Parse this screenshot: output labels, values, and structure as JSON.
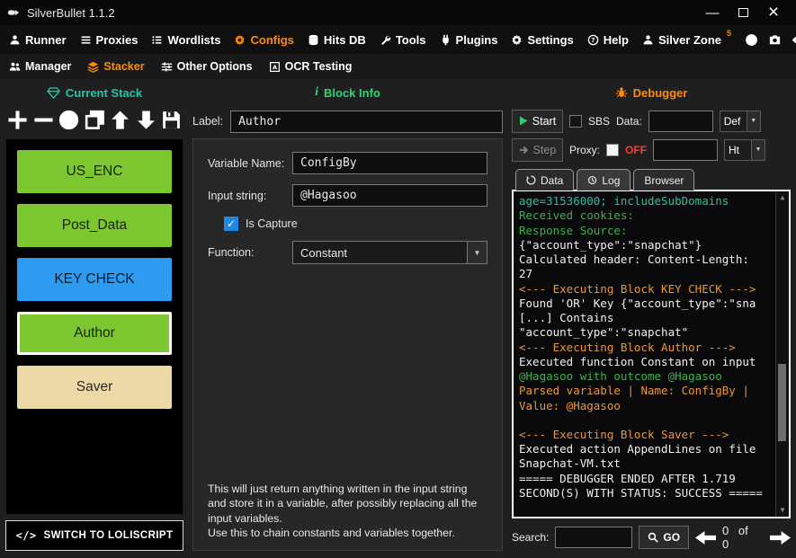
{
  "titlebar": {
    "title": "SilverBullet 1.1.2",
    "minimize": "—",
    "close": "×"
  },
  "menu": {
    "items": [
      {
        "label": "Runner"
      },
      {
        "label": "Proxies"
      },
      {
        "label": "Wordlists"
      },
      {
        "label": "Configs"
      },
      {
        "label": "Hits DB"
      },
      {
        "label": "Tools"
      },
      {
        "label": "Plugins"
      },
      {
        "label": "Settings"
      },
      {
        "label": "Help"
      },
      {
        "label": "Silver Zone",
        "badge": "5"
      }
    ]
  },
  "submenu": {
    "items": [
      {
        "label": "Manager"
      },
      {
        "label": "Stacker"
      },
      {
        "label": "Other Options"
      },
      {
        "label": "OCR Testing"
      }
    ]
  },
  "stack": {
    "header": "Current Stack",
    "blocks": [
      {
        "label": "US_ENC",
        "color": "#7CC62F"
      },
      {
        "label": "Post_Data",
        "color": "#7CC62F"
      },
      {
        "label": "KEY CHECK",
        "color": "#2D9BF0"
      },
      {
        "label": "Author",
        "color": "#7CC62F",
        "selected": true
      },
      {
        "label": "Saver",
        "color": "#EBD9A8"
      }
    ],
    "switch_icon": "</>",
    "switch_button": "SWITCH TO LOLISCRIPT"
  },
  "block_info": {
    "header": "Block Info",
    "label_caption": "Label:",
    "label_value": "Author",
    "fields": {
      "variable_name_caption": "Variable Name:",
      "variable_name_value": "ConfigBy",
      "input_string_caption": "Input string:",
      "input_string_value": "@Hagasoo",
      "is_capture_label": "Is Capture",
      "function_caption": "Function:",
      "function_value": "Constant"
    },
    "description": "This will just return anything written in the input string and store it in a variable, after possibly replacing all the input variables.\nUse this to chain constants and variables together."
  },
  "debugger": {
    "header": "Debugger",
    "controls": {
      "start": "Start",
      "sbs": "SBS",
      "data_caption": "Data:",
      "data_value": "",
      "data_dropdown": "Def",
      "step": "Step",
      "proxy_caption": "Proxy:",
      "proxy_state": "OFF",
      "proxy_value": "",
      "proxy_dropdown": "Ht"
    },
    "tabs": [
      {
        "label": "Data"
      },
      {
        "label": "Log"
      },
      {
        "label": "Browser"
      }
    ],
    "log": [
      {
        "c": "teal",
        "t": "age=31536000; includeSubDomains"
      },
      {
        "c": "green",
        "t": "Received cookies:"
      },
      {
        "c": "green",
        "t": "Response Source:"
      },
      {
        "c": "white",
        "t": "{\"account_type\":\"snapchat\"}"
      },
      {
        "c": "white",
        "t": "Calculated header: Content-Length: 27"
      },
      {
        "c": "orange",
        "t": "<--- Executing Block KEY CHECK --->"
      },
      {
        "c": "white",
        "t": "Found 'OR' Key {\"account_type\":\"sna [...] Contains \"account_type\":\"snapchat\""
      },
      {
        "c": "orange",
        "t": "<--- Executing Block Author --->"
      },
      {
        "c": "white",
        "t": "Executed function Constant on input"
      },
      {
        "c": "green",
        "t": "@Hagasoo with outcome @Hagasoo"
      },
      {
        "c": "orange",
        "t": "Parsed variable | Name: ConfigBy | Value: @Hagasoo"
      },
      {
        "c": "white",
        "t": ""
      },
      {
        "c": "orange",
        "t": "<--- Executing Block Saver --->"
      },
      {
        "c": "white",
        "t": "Executed action AppendLines on file Snapchat-VM.txt"
      },
      {
        "c": "white",
        "t": "===== DEBUGGER ENDED AFTER 1.719 SECOND(S) WITH STATUS: SUCCESS ====="
      }
    ],
    "search": {
      "caption": "Search:",
      "value": "",
      "go": "GO",
      "counter": "0 of 0"
    }
  },
  "icons": {
    "dropdown_arrow": "▼",
    "check": "✓",
    "scroll_up": "▲",
    "scroll_down": "▼"
  },
  "colors": {
    "accent_orange": "#FF8C00",
    "header_teal": "#1FC8A2",
    "header_green": "#2ED573",
    "proxy_off_red": "#FF3B30",
    "capture_blue": "#1E88E5"
  }
}
